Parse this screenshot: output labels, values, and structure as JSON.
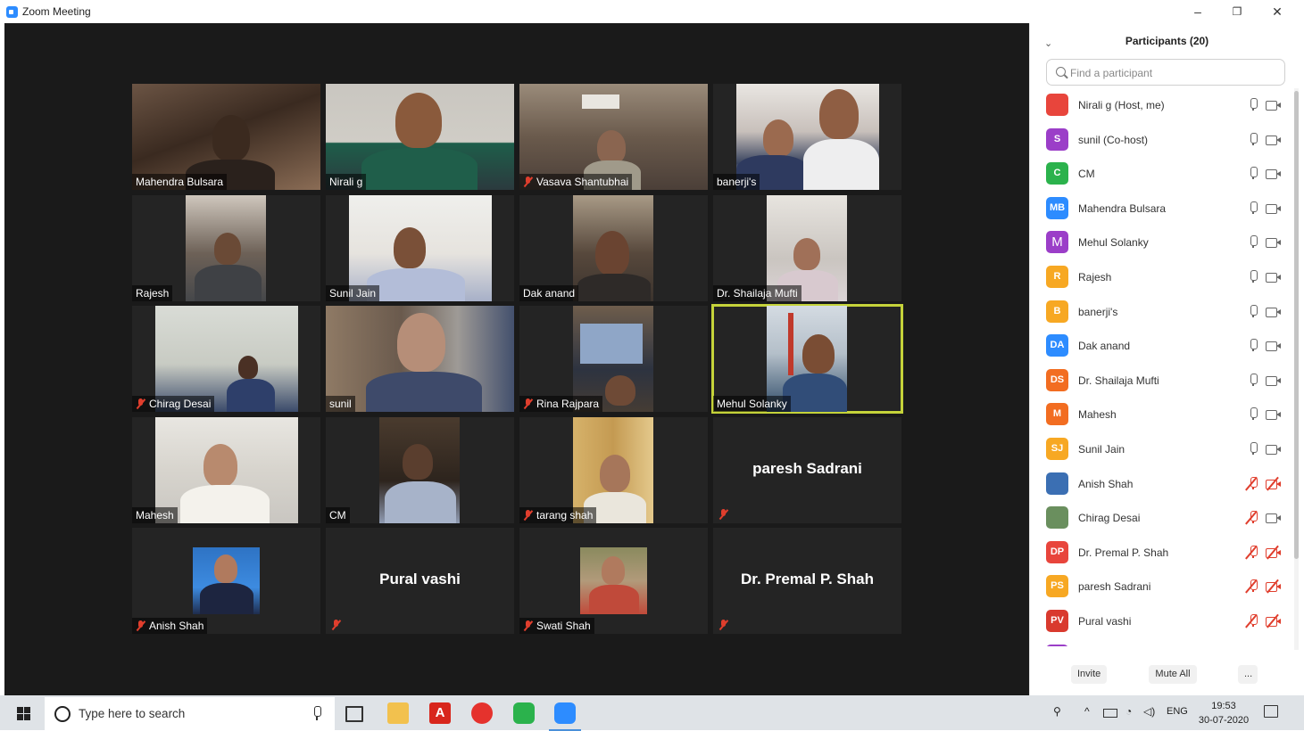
{
  "window": {
    "title": "Zoom Meeting",
    "minimize_glyph": "–",
    "restore_glyph": "❐",
    "close_glyph": "✕"
  },
  "gallery": {
    "tiles": [
      {
        "name": "Mahendra Bulsara",
        "muted": false
      },
      {
        "name": "Nirali g",
        "muted": false
      },
      {
        "name": "Vasava Shantubhai",
        "muted": true
      },
      {
        "name": "banerji's",
        "muted": false
      },
      {
        "name": "Rajesh",
        "muted": false
      },
      {
        "name": "Sunil Jain",
        "muted": false
      },
      {
        "name": "Dak anand",
        "muted": false
      },
      {
        "name": "Dr. Shailaja Mufti",
        "muted": false
      },
      {
        "name": "Chirag Desai",
        "muted": true
      },
      {
        "name": "sunil",
        "muted": false
      },
      {
        "name": "Rina Rajpara",
        "muted": true
      },
      {
        "name": "Mehul Solanky",
        "muted": false,
        "active_speaker": true
      },
      {
        "name": "Mahesh",
        "muted": false
      },
      {
        "name": "CM",
        "muted": false
      },
      {
        "name": "tarang shah",
        "muted": true
      },
      {
        "name": "paresh Sadrani",
        "muted": true,
        "video_off": true
      },
      {
        "name": "Anish Shah",
        "muted": true
      },
      {
        "name": "Pural vashi",
        "muted": true,
        "video_off": true
      },
      {
        "name": "Swati Shah",
        "muted": true
      },
      {
        "name": "Dr. Premal P. Shah",
        "muted": true,
        "video_off": true
      }
    ]
  },
  "panel": {
    "collapse_glyph": "⌄",
    "title": "Participants (20)",
    "search_placeholder": "Find a participant",
    "participants": [
      {
        "name": "Nirali g (Host, me)",
        "initials": "",
        "color": "#e8453c",
        "mic_muted": false,
        "cam_off": false,
        "photo": true
      },
      {
        "name": "sunil (Co-host)",
        "initials": "S",
        "color": "#9b3ec8",
        "mic_muted": false,
        "cam_off": false
      },
      {
        "name": "CM",
        "initials": "C",
        "color": "#2bb24c",
        "mic_muted": false,
        "cam_off": false
      },
      {
        "name": "Mahendra Bulsara",
        "initials": "MB",
        "color": "#2d8cff",
        "mic_muted": false,
        "cam_off": false
      },
      {
        "name": "Mehul Solanky",
        "initials": "M",
        "color": "#9b3ec8",
        "mic_muted": false,
        "cam_off": false,
        "big": true
      },
      {
        "name": "Rajesh",
        "initials": "R",
        "color": "#f7a823",
        "mic_muted": false,
        "cam_off": false
      },
      {
        "name": "banerji's",
        "initials": "B",
        "color": "#f7a823",
        "mic_muted": false,
        "cam_off": false
      },
      {
        "name": "Dak anand",
        "initials": "DA",
        "color": "#2d8cff",
        "mic_muted": false,
        "cam_off": false
      },
      {
        "name": "Dr. Shailaja Mufti",
        "initials": "DS",
        "color": "#f26d21",
        "mic_muted": false,
        "cam_off": false
      },
      {
        "name": "Mahesh",
        "initials": "M",
        "color": "#f26d21",
        "mic_muted": false,
        "cam_off": false
      },
      {
        "name": "Sunil Jain",
        "initials": "SJ",
        "color": "#f7a823",
        "mic_muted": false,
        "cam_off": false
      },
      {
        "name": "Anish Shah",
        "initials": "",
        "color": "#3b6fb3",
        "mic_muted": true,
        "cam_off": true,
        "photo": true
      },
      {
        "name": "Chirag Desai",
        "initials": "",
        "color": "#6a8f5e",
        "mic_muted": true,
        "cam_off": false,
        "photo": true
      },
      {
        "name": "Dr. Premal P. Shah",
        "initials": "DP",
        "color": "#e8453c",
        "mic_muted": true,
        "cam_off": true
      },
      {
        "name": "paresh Sadrani",
        "initials": "PS",
        "color": "#f7a823",
        "mic_muted": true,
        "cam_off": true
      },
      {
        "name": "Pural vashi",
        "initials": "PV",
        "color": "#d93a2e",
        "mic_muted": true,
        "cam_off": true
      }
    ],
    "invite_label": "Invite",
    "mute_all_label": "Mute All",
    "more_label": "..."
  },
  "taskbar": {
    "search_text": "Type here to search",
    "language": "ENG",
    "time": "19:53",
    "date": "30-07-2020"
  }
}
